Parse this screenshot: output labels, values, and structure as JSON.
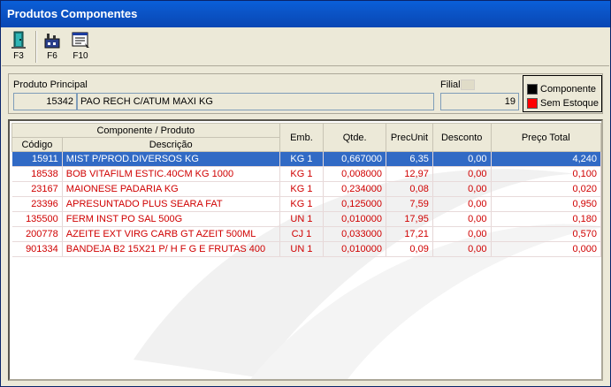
{
  "window": {
    "title": "Produtos Componentes"
  },
  "toolbar": {
    "buttons": [
      {
        "label": "F3",
        "icon": "exit-door-icon"
      },
      {
        "label": "F6",
        "icon": "factory-icon"
      },
      {
        "label": "F10",
        "icon": "print-list-icon"
      }
    ]
  },
  "header": {
    "produto_label": "Produto Principal",
    "produto_code": "15342",
    "produto_desc": "PAO RECH C/ATUM MAXI KG",
    "filial_label": "Filial",
    "filial_value": "19"
  },
  "legend": {
    "componente": {
      "label": "Componente",
      "color": "#000000"
    },
    "sem_estoque": {
      "label": "Sem Estoque",
      "color": "#ff0000"
    }
  },
  "table": {
    "group_header": "Componente / Produto",
    "headers": {
      "codigo": "Código",
      "descricao": "Descrição",
      "emb": "Emb.",
      "qtde": "Qtde.",
      "precunit": "PrecUnit",
      "desconto": "Desconto",
      "preco_total": "Preço Total"
    },
    "rows": [
      {
        "codigo": "15911",
        "descricao": "MIST P/PROD.DIVERSOS  KG",
        "emb": "KG 1",
        "qtde": "0,667000",
        "precunit": "6,35",
        "desconto": "0,00",
        "preco_total": "4,240"
      },
      {
        "codigo": "18538",
        "descricao": "BOB VITAFILM ESTIC.40CM KG 1000",
        "emb": "KG 1",
        "qtde": "0,008000",
        "precunit": "12,97",
        "desconto": "0,00",
        "preco_total": "0,100"
      },
      {
        "codigo": "23167",
        "descricao": "MAIONESE PADARIA KG",
        "emb": "KG 1",
        "qtde": "0,234000",
        "precunit": "0,08",
        "desconto": "0,00",
        "preco_total": "0,020"
      },
      {
        "codigo": "23396",
        "descricao": "APRESUNTADO PLUS SEARA FAT",
        "emb": "KG 1",
        "qtde": "0,125000",
        "precunit": "7,59",
        "desconto": "0,00",
        "preco_total": "0,950"
      },
      {
        "codigo": "135500",
        "descricao": "FERM INST PO SAL 500G",
        "emb": "UN 1",
        "qtde": "0,010000",
        "precunit": "17,95",
        "desconto": "0,00",
        "preco_total": "0,180"
      },
      {
        "codigo": "200778",
        "descricao": "AZEITE EXT VIRG CARB GT AZEIT 500ML",
        "emb": "CJ 1",
        "qtde": "0,033000",
        "precunit": "17,21",
        "desconto": "0,00",
        "preco_total": "0,570"
      },
      {
        "codigo": "901334",
        "descricao": "BANDEJA B2 15X21 P/ H F G E FRUTAS 400",
        "emb": "UN 1",
        "qtde": "0,010000",
        "precunit": "0,09",
        "desconto": "0,00",
        "preco_total": "0,000"
      }
    ]
  }
}
